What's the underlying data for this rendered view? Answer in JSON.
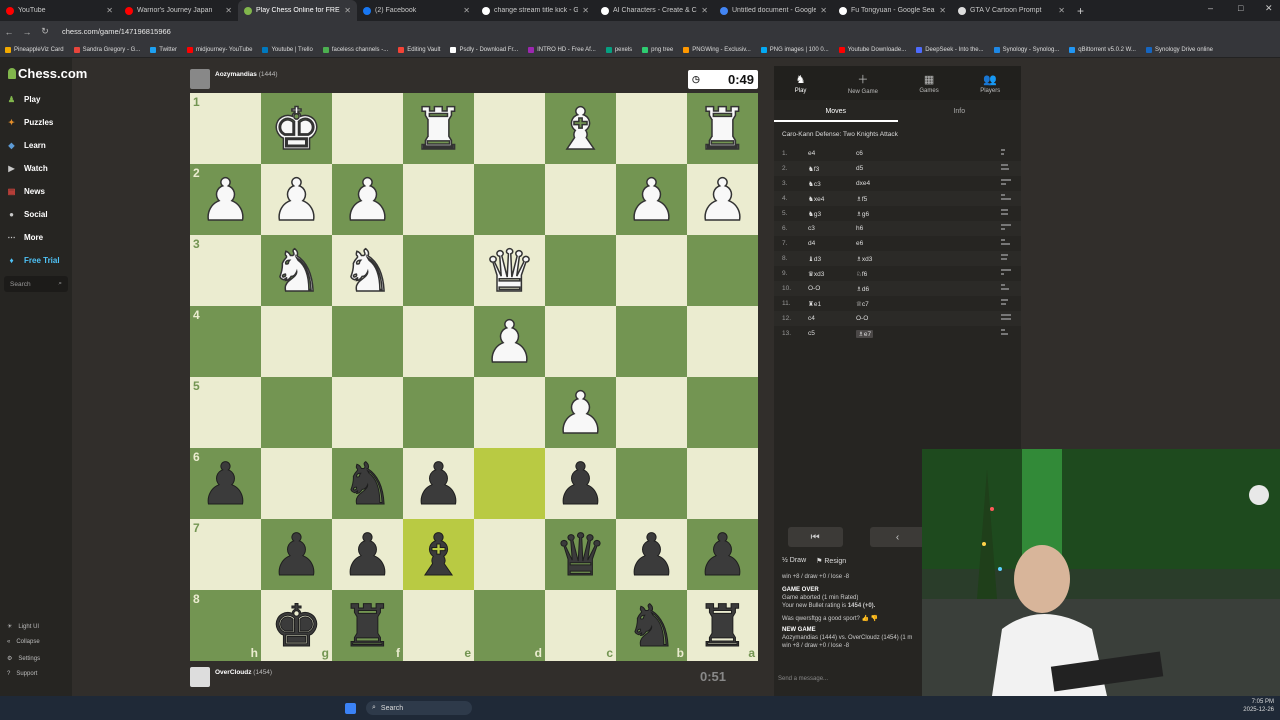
{
  "browser": {
    "tabs": [
      {
        "title": "YouTube",
        "color": "#ff0000"
      },
      {
        "title": "Warrior's Journey Japan",
        "color": "#ff0000"
      },
      {
        "title": "Play Chess Online for FREE",
        "color": "#81b64c",
        "active": true
      },
      {
        "title": "(2) Facebook",
        "color": "#1877f2"
      },
      {
        "title": "change stream title kick - Goog",
        "color": "#ffffff"
      },
      {
        "title": "AI Characters - Create & Custom",
        "color": "#ffffff"
      },
      {
        "title": "Untitled document - Google Do",
        "color": "#4285f4"
      },
      {
        "title": "Fu Tongyuan - Google Search",
        "color": "#ffffff"
      },
      {
        "title": "GTA V Cartoon Prompt",
        "color": "#dddddd"
      }
    ],
    "url": "chess.com/game/147196815966",
    "bookmarks": [
      "PineappleViz Card",
      "Sandra Gregory - G...",
      "Twitter",
      "midjourney- YouTube",
      "Youtube | Trello",
      "faceless channels -...",
      "Editing Vault",
      "Psdly - Download Fr...",
      "INTRO HD - Free Af...",
      "pexels",
      "png tree",
      "PNGWing - Exclusiv...",
      "PNG images | 100 0...",
      "Youtube Downloade...",
      "DeepSeek - Into the...",
      "Synology - Synolog...",
      "qBittorrent v5.0.2 W...",
      "Synology Drive online"
    ]
  },
  "sidebar": {
    "logo": "Chess.com",
    "items": [
      {
        "label": "Play",
        "color": "#81b64c"
      },
      {
        "label": "Puzzles",
        "color": "#e58f2a"
      },
      {
        "label": "Learn",
        "color": "#5d9bd5"
      },
      {
        "label": "Watch",
        "color": "#c8c8c8"
      },
      {
        "label": "News",
        "color": "#e2463f"
      },
      {
        "label": "Social",
        "color": "#c8c8c8"
      },
      {
        "label": "More",
        "color": "#c8c8c8"
      },
      {
        "label": "Free Trial",
        "color": "#4fc3f7"
      }
    ],
    "search_placeholder": "Search",
    "footer": [
      "Light UI",
      "Collapse",
      "Settings",
      "Support"
    ]
  },
  "game": {
    "top_player": {
      "name": "Aozymandias",
      "rating": "(1444)"
    },
    "top_clock": "0:49",
    "bottom_player": {
      "name": "OverCloudz",
      "rating": "(1454)"
    },
    "bottom_clock": "0:51",
    "ranks": [
      "1",
      "2",
      "3",
      "4",
      "5",
      "6",
      "7",
      "8"
    ],
    "files": [
      "h",
      "g",
      "f",
      "e",
      "d",
      "c",
      "b",
      "a"
    ],
    "board": [
      [
        "",
        "wK",
        "",
        "wR",
        "",
        "wB",
        "",
        "wR"
      ],
      [
        "wP",
        "wP",
        "wP",
        "",
        "",
        "",
        "wP",
        "wP"
      ],
      [
        "",
        "wN",
        "wN",
        "",
        "wQ",
        "",
        "",
        ""
      ],
      [
        "",
        "",
        "",
        "",
        "wP",
        "",
        "",
        ""
      ],
      [
        "",
        "",
        "",
        "",
        "",
        "wP",
        "",
        ""
      ],
      [
        "bP",
        "",
        "bN",
        "bP",
        "",
        "bP",
        "",
        ""
      ],
      [
        "",
        "bP",
        "bP",
        "bB",
        "",
        "bQ",
        "bP",
        "bP"
      ],
      [
        "",
        "bK",
        "bR",
        "",
        "",
        "",
        "bN",
        "bR"
      ]
    ]
  },
  "panel": {
    "tabs": [
      "Play",
      "New Game",
      "Games",
      "Players"
    ],
    "subtabs": [
      "Moves",
      "Info"
    ],
    "opening": "Caro-Kann Defense: Two Knights Attack",
    "moves": [
      {
        "n": "1.",
        "w": "e4",
        "b": "c6"
      },
      {
        "n": "2.",
        "w": "♞f3",
        "b": "d5"
      },
      {
        "n": "3.",
        "w": "♞c3",
        "b": "dxe4"
      },
      {
        "n": "4.",
        "w": "♞xe4",
        "b": "♗f5"
      },
      {
        "n": "5.",
        "w": "♞g3",
        "b": "♗g6"
      },
      {
        "n": "6.",
        "w": "c3",
        "b": "h6"
      },
      {
        "n": "7.",
        "w": "d4",
        "b": "e6"
      },
      {
        "n": "8.",
        "w": "♝d3",
        "b": "♗xd3"
      },
      {
        "n": "9.",
        "w": "♛xd3",
        "b": "♘f6"
      },
      {
        "n": "10.",
        "w": "O-O",
        "b": "♗d6"
      },
      {
        "n": "11.",
        "w": "♜e1",
        "b": "♕c7"
      },
      {
        "n": "12.",
        "w": "c4",
        "b": "O-O"
      },
      {
        "n": "13.",
        "w": "c5",
        "b": "♗e7"
      }
    ],
    "draw": "Draw",
    "resign": "Resign",
    "chat": {
      "line1": "win +8 / draw +0 / lose -8",
      "over": "GAME OVER",
      "aborted": "Game aborted (1 min Rated)",
      "rating_prefix": "Your new Bullet rating is ",
      "rating_value": "1454 (+0).",
      "sport": "Was qwersftgg a good sport?",
      "newgame": "NEW GAME",
      "newgame_line": "Aozymandias (1444) vs. OverCloudz (1454) (1 m",
      "newgame_line2": "win +8 / draw +0 / lose -8"
    },
    "send_placeholder": "Send a message..."
  },
  "taskbar": {
    "search": "Search",
    "time": "7:05 PM",
    "date": "2025-12-26"
  }
}
